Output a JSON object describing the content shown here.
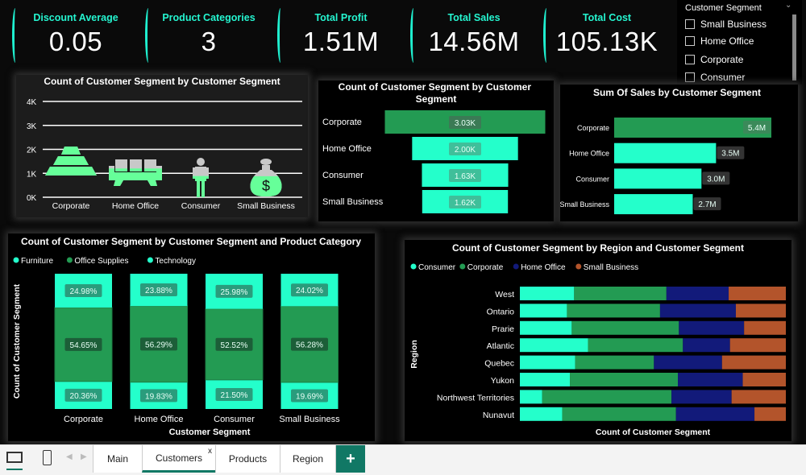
{
  "colors": {
    "aqua": "#24ffcb",
    "green": "#239b53",
    "navy": "#121a7a",
    "orange": "#b3542b",
    "picto_green": "#66ff99",
    "picto_grey": "#c8c8c8",
    "accent_tab": "#117865"
  },
  "kpis": [
    {
      "title": "Discount Average",
      "value": "0.05"
    },
    {
      "title": "Product Categories",
      "value": "3"
    },
    {
      "title": "Total Profit",
      "value": "1.51M"
    },
    {
      "title": "Total Sales",
      "value": "14.56M"
    },
    {
      "title": "Total Cost",
      "value": "105.13K"
    }
  ],
  "slicer": {
    "title": "Customer Segment",
    "items": [
      "Small Business",
      "Home Office",
      "Corporate",
      "Consumer"
    ]
  },
  "chart_data": [
    {
      "type": "bar",
      "subtype": "pictograph",
      "title": "Count of Customer Segment by Customer Segment",
      "categories": [
        "Corporate",
        "Home Office",
        "Consumer",
        "Small Business"
      ],
      "values": [
        3030,
        2000,
        1630,
        1620
      ],
      "icons": [
        "gold-bars-icon",
        "sofa-icon",
        "person-icon",
        "money-bag-icon"
      ],
      "yticks": [
        "0K",
        "1K",
        "2K",
        "3K",
        "4K"
      ],
      "ylim": [
        0,
        4000
      ],
      "grid": true
    },
    {
      "type": "bar",
      "subtype": "funnel",
      "title": "Count of Customer Segment by Customer Segment",
      "categories": [
        "Corporate",
        "Home Office",
        "Consumer",
        "Small Business"
      ],
      "values": [
        3030,
        2000,
        1630,
        1620
      ],
      "labels": [
        "3.03K",
        "2.00K",
        "1.63K",
        "1.62K"
      ]
    },
    {
      "type": "bar",
      "orientation": "horizontal",
      "title": "Sum Of Sales by Customer Segment",
      "categories": [
        "Corporate",
        "Home Office",
        "Consumer",
        "Small Business"
      ],
      "values": [
        5.4,
        3.5,
        3.0,
        2.7
      ],
      "labels": [
        "5.4M",
        "3.5M",
        "3.0M",
        "2.7M"
      ]
    },
    {
      "type": "bar",
      "subtype": "100% stacked column",
      "title": "Count of Customer Segment by Customer Segment and Product Category",
      "xlabel": "Customer Segment",
      "ylabel": "Count of Customer Segment",
      "legend": "top-left",
      "categories": [
        "Corporate",
        "Home Office",
        "Consumer",
        "Small Business"
      ],
      "series": [
        {
          "name": "Furniture",
          "values": [
            20.36,
            19.83,
            21.5,
            19.69
          ],
          "labels": [
            "20.36%",
            "19.83%",
            "21.50%",
            "19.69%"
          ]
        },
        {
          "name": "Office Supplies",
          "values": [
            54.65,
            56.29,
            52.52,
            56.28
          ],
          "labels": [
            "54.65%",
            "56.29%",
            "52.52%",
            "56.28%"
          ]
        },
        {
          "name": "Technology",
          "values": [
            24.98,
            23.88,
            25.98,
            24.02
          ],
          "labels": [
            "24.98%",
            "23.88%",
            "25.98%",
            "24.02%"
          ]
        }
      ]
    },
    {
      "type": "bar",
      "subtype": "100% stacked bar",
      "title": "Count of Customer Segment by Region and Customer Segment",
      "xlabel": "Count of Customer Segment",
      "ylabel": "Region",
      "legend": "top-left",
      "categories": [
        "West",
        "Ontario",
        "Prarie",
        "Atlantic",
        "Quebec",
        "Yukon",
        "Northwest Territories",
        "Nunavut"
      ],
      "series": [
        {
          "name": "Consumer",
          "values": [
            20.4,
            17.7,
            19.5,
            25.6,
            20.8,
            18.8,
            8.4,
            15.9
          ]
        },
        {
          "name": "Corporate",
          "values": [
            34.7,
            35.0,
            40.3,
            35.7,
            29.6,
            40.6,
            48.6,
            42.8
          ]
        },
        {
          "name": "Home Office",
          "values": [
            23.4,
            28.5,
            24.5,
            17.7,
            25.6,
            24.4,
            22.6,
            29.5
          ]
        },
        {
          "name": "Small Business",
          "values": [
            21.5,
            18.8,
            15.7,
            21.0,
            24.0,
            16.2,
            20.4,
            11.8
          ]
        }
      ]
    }
  ],
  "tabs": {
    "items": [
      "Main",
      "Customers",
      "Products",
      "Region"
    ],
    "active": "Customers",
    "close": "x",
    "add": "+"
  }
}
